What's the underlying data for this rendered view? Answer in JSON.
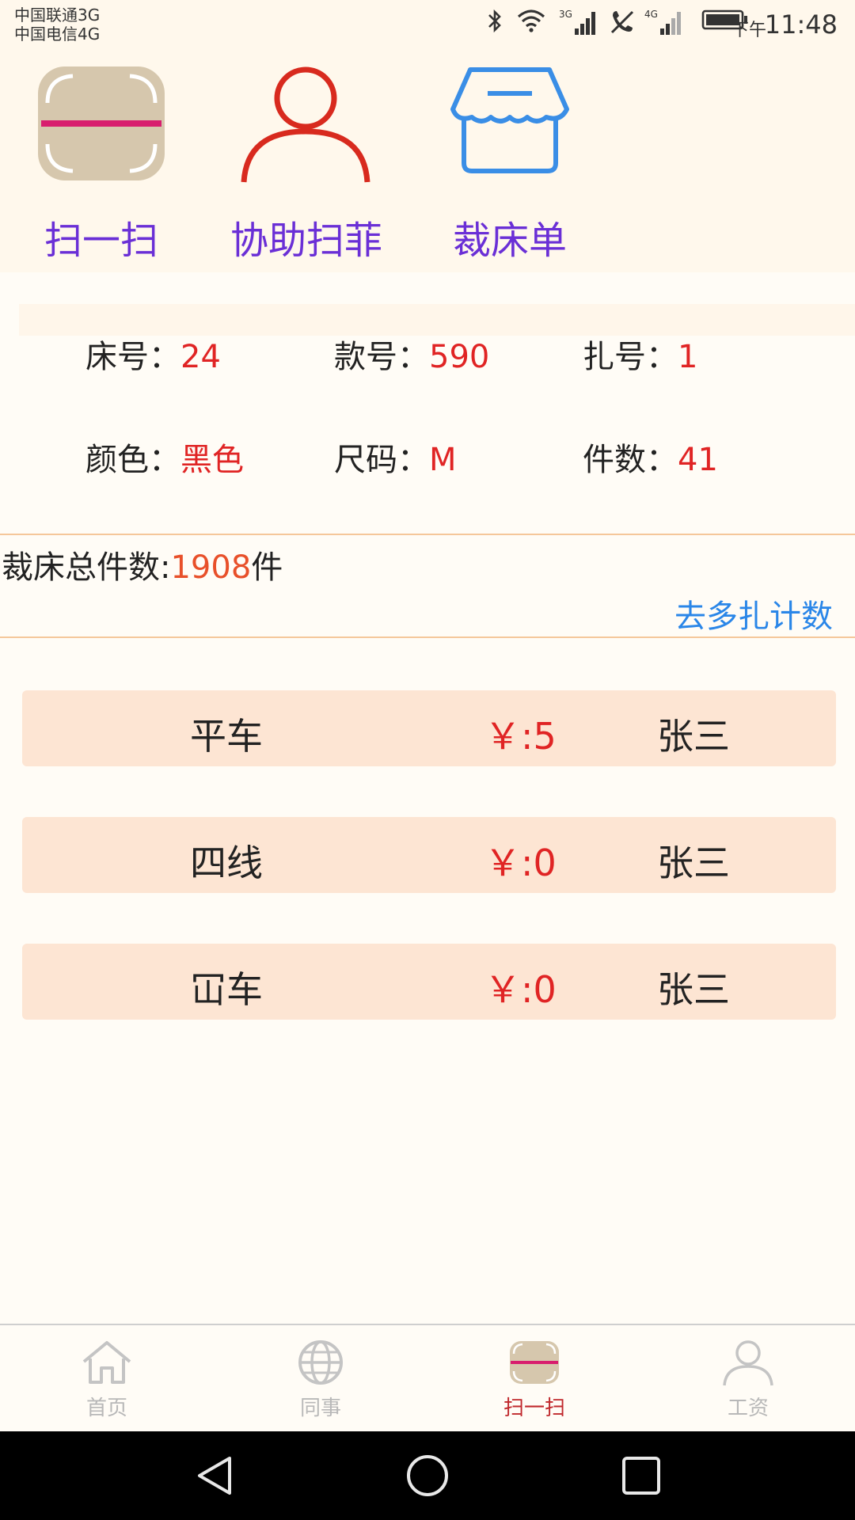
{
  "status_bar": {
    "carrier_1": "中国联通3G",
    "carrier_2": "中国电信4G",
    "time_prefix": "下午",
    "time": "11:48",
    "net_1": "3G",
    "net_2": "4G"
  },
  "actions": [
    {
      "label": "扫一扫",
      "icon": "scan-icon"
    },
    {
      "label": "协助扫菲",
      "icon": "person-icon"
    },
    {
      "label": "裁床单",
      "icon": "store-icon"
    }
  ],
  "info": {
    "bed_label": "床号：",
    "bed_value": "24",
    "style_label": "款号：",
    "style_value": "590",
    "bundle_label": "扎号：",
    "bundle_value": "1",
    "color_label": "颜色：",
    "color_value": "黑色",
    "size_label": "尺码：",
    "size_value": "M",
    "count_label": "件数：",
    "count_value": "41"
  },
  "total": {
    "label": "裁床总件数:",
    "value": "1908",
    "unit": "件",
    "link": "去多扎计数"
  },
  "processes": [
    {
      "name": "平车",
      "price": "￥:5",
      "worker": "张三"
    },
    {
      "name": "四线",
      "price": "￥:0",
      "worker": "张三"
    },
    {
      "name": "冚车",
      "price": "￥:0",
      "worker": "张三"
    }
  ],
  "tabs": [
    {
      "label": "首页",
      "icon": "home-icon",
      "active": false
    },
    {
      "label": "同事",
      "icon": "globe-icon",
      "active": false
    },
    {
      "label": "扫一扫",
      "icon": "scan-icon",
      "active": true
    },
    {
      "label": "工资",
      "icon": "person-icon",
      "active": false
    }
  ],
  "colors": {
    "accent_purple": "#6a2fd6",
    "value_red": "#e02424",
    "link_blue": "#2a86e8",
    "row_bg": "#fde5d3",
    "tab_active": "#c0282c"
  }
}
